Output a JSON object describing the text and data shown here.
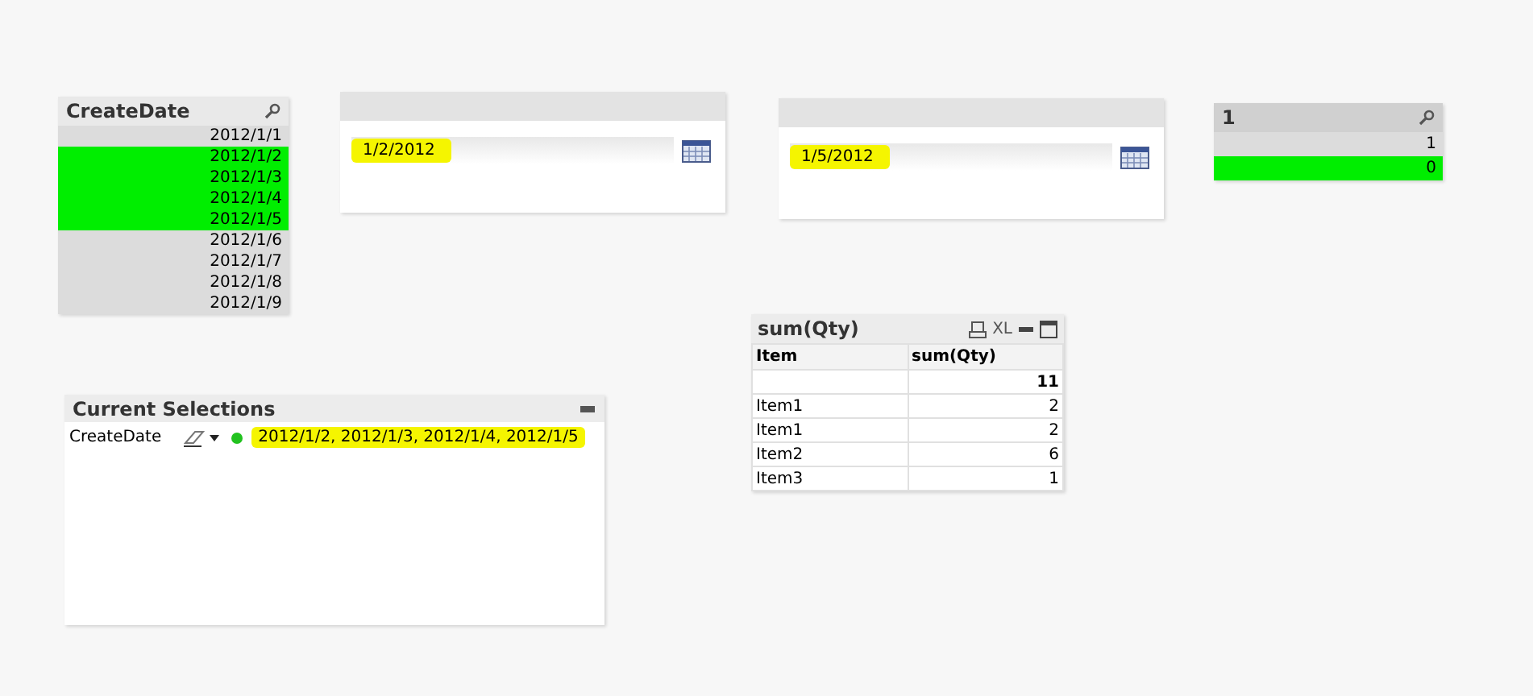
{
  "createdate_listbox": {
    "title": "CreateDate",
    "values": [
      {
        "label": "2012/1/1",
        "selected": false
      },
      {
        "label": "2012/1/2",
        "selected": true
      },
      {
        "label": "2012/1/3",
        "selected": true
      },
      {
        "label": "2012/1/4",
        "selected": true
      },
      {
        "label": "2012/1/5",
        "selected": true
      },
      {
        "label": "2012/1/6",
        "selected": false
      },
      {
        "label": "2012/1/7",
        "selected": false
      },
      {
        "label": "2012/1/8",
        "selected": false
      },
      {
        "label": "2012/1/9",
        "selected": false
      }
    ]
  },
  "input_boxes": [
    {
      "value": "1/2/2012",
      "highlighted": true
    },
    {
      "value": "1/5/2012",
      "highlighted": true
    }
  ],
  "flag_listbox": {
    "title": "1",
    "values": [
      {
        "label": "1",
        "selected": false
      },
      {
        "label": "0",
        "selected": true
      }
    ]
  },
  "current_selections": {
    "title": "Current Selections",
    "field": "CreateDate",
    "values": "2012/1/2, 2012/1/3, 2012/1/4, 2012/1/5",
    "highlighted": true
  },
  "table": {
    "title": "sum(Qty)",
    "export_label": "XL",
    "columns": [
      "Item",
      "sum(Qty)"
    ],
    "total": "11",
    "rows": [
      {
        "item": "Item1",
        "qty": "2"
      },
      {
        "item": "Item1",
        "qty": "2"
      },
      {
        "item": "Item2",
        "qty": "6"
      },
      {
        "item": "Item3",
        "qty": "1"
      }
    ]
  }
}
